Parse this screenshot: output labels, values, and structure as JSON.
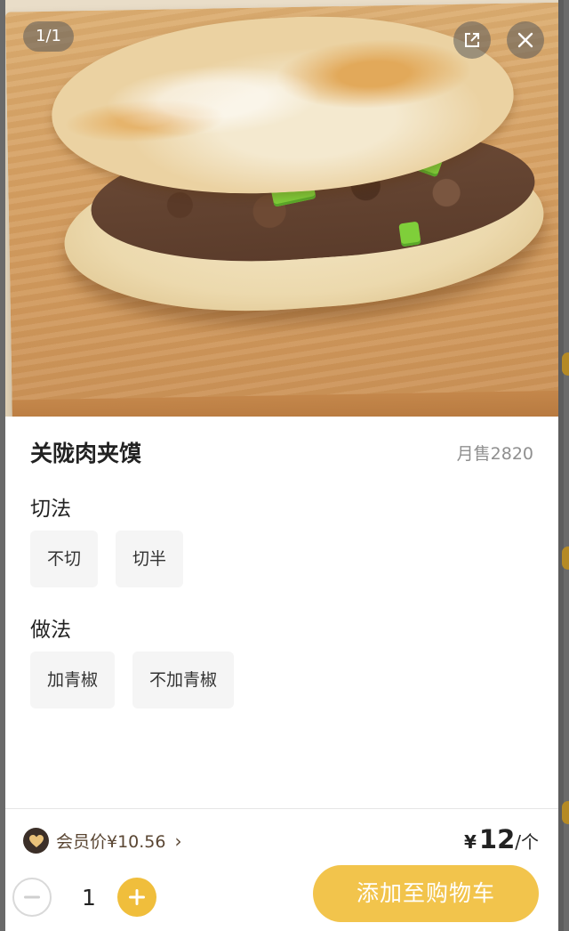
{
  "gallery": {
    "page_indicator": "1/1",
    "share_icon": "external-share-icon",
    "close_icon": "close-icon"
  },
  "product": {
    "name": "关陇肉夹馍",
    "monthly_sales": "月售2820"
  },
  "options": [
    {
      "heading": "切法",
      "choices": [
        "不切",
        "切半"
      ]
    },
    {
      "heading": "做法",
      "choices": [
        "加青椒",
        "不加青椒"
      ]
    }
  ],
  "member": {
    "icon": "heart-member-icon",
    "label": "会员价¥10.56",
    "chevron": "›"
  },
  "price": {
    "currency": "¥",
    "amount": "12",
    "unit": "/个"
  },
  "cart": {
    "quantity": "1",
    "add_label": "添加至购物车"
  },
  "colors": {
    "accent": "#f2c44c",
    "plus_button": "#f0be3c",
    "member_badge": "#3b2f28"
  }
}
